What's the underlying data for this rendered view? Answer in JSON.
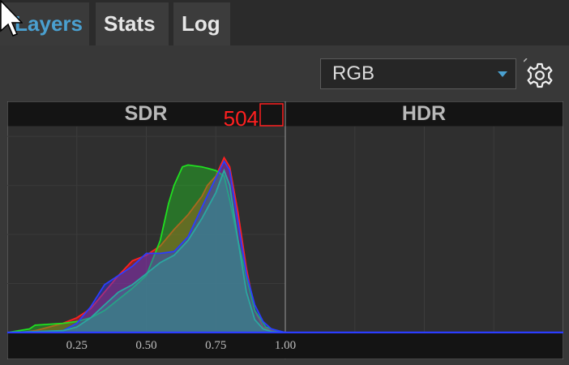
{
  "tabs": [
    {
      "label": "Layers",
      "active": true
    },
    {
      "label": "Stats",
      "active": false
    },
    {
      "label": "Log",
      "active": false
    }
  ],
  "channel_select": {
    "value": "RGB"
  },
  "icons": {
    "settings": "gear-icon",
    "dropdown": "chevron-down-icon",
    "cursor": "mouse-pointer-icon"
  },
  "colors": {
    "accent": "#4aa0d0",
    "peak_marker": "#ff2020"
  },
  "chart_data": {
    "type": "area",
    "panels": [
      "SDR",
      "HDR"
    ],
    "peak_label": "504",
    "x_ticks": [
      "0.25",
      "0.50",
      "0.75",
      "1.00"
    ],
    "xlim": [
      0,
      2
    ],
    "series": [
      {
        "color": "#ff2020",
        "x": [
          0,
          0.05,
          0.1,
          0.15,
          0.2,
          0.25,
          0.3,
          0.35,
          0.4,
          0.45,
          0.5,
          0.55,
          0.6,
          0.65,
          0.7,
          0.72,
          0.75,
          0.78,
          0.8,
          0.83,
          0.86,
          0.89,
          0.92,
          0.95,
          1.0,
          1.05
        ],
        "y": [
          0,
          0,
          0.01,
          0.03,
          0.05,
          0.08,
          0.13,
          0.22,
          0.31,
          0.39,
          0.42,
          0.47,
          0.56,
          0.64,
          0.74,
          0.8,
          0.85,
          0.95,
          0.9,
          0.65,
          0.35,
          0.12,
          0.03,
          0.01,
          0,
          0
        ]
      },
      {
        "color": "#20e020",
        "x": [
          0,
          0.08,
          0.1,
          0.2,
          0.25,
          0.3,
          0.35,
          0.4,
          0.45,
          0.5,
          0.55,
          0.58,
          0.6,
          0.63,
          0.65,
          0.7,
          0.75,
          0.78,
          0.8,
          0.83,
          0.86,
          0.89,
          0.93,
          0.97,
          1.0
        ],
        "y": [
          0,
          0.02,
          0.04,
          0.05,
          0.06,
          0.08,
          0.12,
          0.18,
          0.24,
          0.31,
          0.5,
          0.7,
          0.8,
          0.9,
          0.91,
          0.9,
          0.88,
          0.85,
          0.72,
          0.5,
          0.3,
          0.12,
          0.03,
          0.01,
          0
        ]
      },
      {
        "color": "#2b3dff",
        "x": [
          0,
          0.2,
          0.25,
          0.3,
          0.35,
          0.4,
          0.45,
          0.5,
          0.55,
          0.6,
          0.65,
          0.7,
          0.75,
          0.78,
          0.8,
          0.83,
          0.86,
          0.89,
          0.92,
          0.95,
          1.0,
          1.05
        ],
        "y": [
          0,
          0.01,
          0.05,
          0.14,
          0.26,
          0.31,
          0.36,
          0.43,
          0.43,
          0.44,
          0.52,
          0.68,
          0.84,
          0.93,
          0.88,
          0.6,
          0.32,
          0.15,
          0.06,
          0.02,
          0,
          0
        ]
      },
      {
        "color": "#2aa8a0",
        "x": [
          0,
          0.2,
          0.25,
          0.3,
          0.35,
          0.4,
          0.45,
          0.5,
          0.55,
          0.6,
          0.65,
          0.7,
          0.75,
          0.78,
          0.8,
          0.83,
          0.86,
          0.89,
          0.92,
          0.95,
          1.0
        ],
        "y": [
          0,
          0.01,
          0.03,
          0.08,
          0.15,
          0.22,
          0.26,
          0.32,
          0.38,
          0.42,
          0.5,
          0.62,
          0.76,
          0.88,
          0.8,
          0.5,
          0.22,
          0.07,
          0.02,
          0.005,
          0
        ]
      }
    ]
  }
}
